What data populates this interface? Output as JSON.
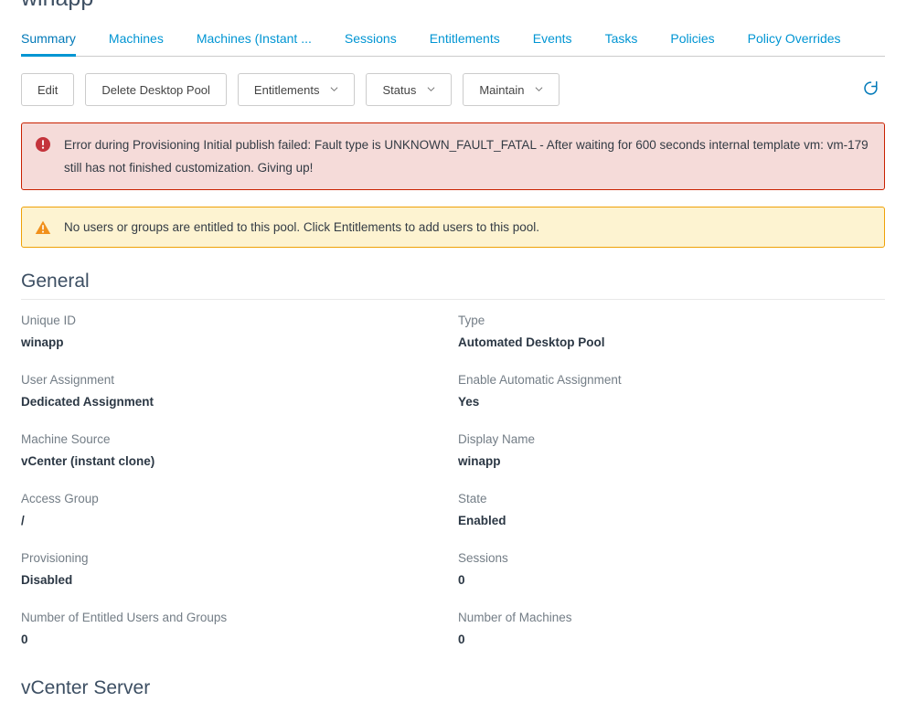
{
  "header": {
    "title": "winapp"
  },
  "tabs": [
    {
      "label": "Summary",
      "active": true
    },
    {
      "label": "Machines",
      "active": false
    },
    {
      "label": "Machines (Instant ...",
      "active": false
    },
    {
      "label": "Sessions",
      "active": false
    },
    {
      "label": "Entitlements",
      "active": false
    },
    {
      "label": "Events",
      "active": false
    },
    {
      "label": "Tasks",
      "active": false
    },
    {
      "label": "Policies",
      "active": false
    },
    {
      "label": "Policy Overrides",
      "active": false
    }
  ],
  "toolbar": {
    "edit_label": "Edit",
    "delete_label": "Delete Desktop Pool",
    "entitlements_label": "Entitlements",
    "status_label": "Status",
    "maintain_label": "Maintain",
    "refresh_icon": "refresh-icon"
  },
  "alerts": {
    "error": {
      "icon": "error-circle-icon",
      "text": "Error during Provisioning Initial publish failed: Fault type is UNKNOWN_FAULT_FATAL - After waiting for 600 seconds internal template vm: vm-179 still has not finished customization. Giving up!",
      "border_color": "#c92100",
      "background_color": "#f5dbd9"
    },
    "warning": {
      "icon": "warning-triangle-icon",
      "text": "No users or groups are entitled to this pool. Click Entitlements to add users to this pool.",
      "border_color": "#efa107",
      "background_color": "#fdf3d1"
    }
  },
  "general": {
    "heading": "General",
    "fields_left": [
      {
        "label": "Unique ID",
        "value": "winapp"
      },
      {
        "label": "User Assignment",
        "value": "Dedicated Assignment"
      },
      {
        "label": "Machine Source",
        "value": "vCenter (instant clone)"
      },
      {
        "label": "Access Group",
        "value": "/"
      },
      {
        "label": "Provisioning",
        "value": "Disabled"
      },
      {
        "label": "Number of Entitled Users and Groups",
        "value": "0"
      }
    ],
    "fields_right": [
      {
        "label": "Type",
        "value": "Automated Desktop Pool"
      },
      {
        "label": "Enable Automatic Assignment",
        "value": "Yes"
      },
      {
        "label": "Display Name",
        "value": "winapp"
      },
      {
        "label": "State",
        "value": "Enabled"
      },
      {
        "label": "Sessions",
        "value": "0"
      },
      {
        "label": "Number of Machines",
        "value": "0"
      }
    ]
  },
  "vcenter": {
    "heading": "vCenter Server"
  },
  "colors": {
    "accent": "#0095d3",
    "tab_link": "#0095d3",
    "tab_active": "#0079b8",
    "heading": "#3d4f63",
    "label": "#737d86",
    "value": "#2b3744"
  }
}
